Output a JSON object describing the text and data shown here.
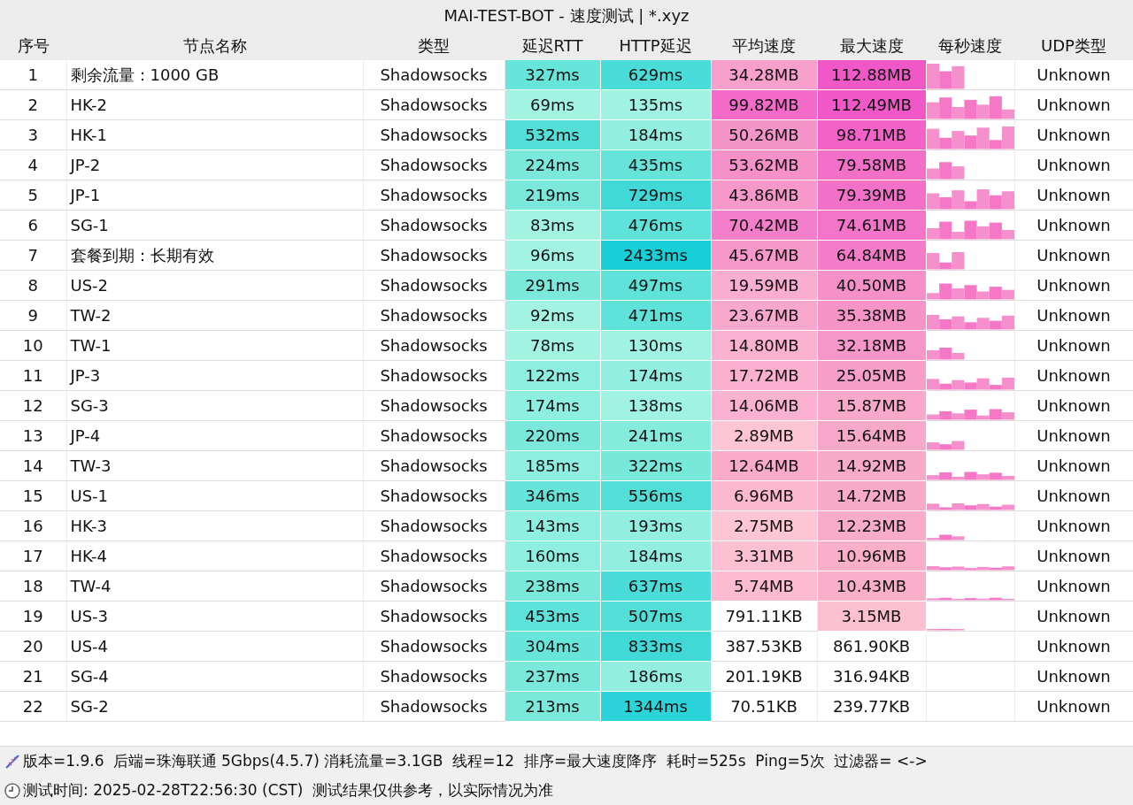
{
  "window": {
    "title": "MAI-TEST-BOT - 速度测试 | *.xyz"
  },
  "table": {
    "columns": [
      "序号",
      "节点名称",
      "类型",
      "延迟RTT",
      "HTTP延迟",
      "平均速度",
      "最大速度",
      "每秒速度",
      "UDP类型"
    ],
    "rows": [
      {
        "index": "1",
        "name": "剩余流量：1000 GB",
        "type": "Shadowsocks",
        "rtt": {
          "text": "327ms",
          "color": "#68e5da"
        },
        "http": {
          "text": "629ms",
          "color": "#4adcd8"
        },
        "avg": {
          "text": "34.28MB",
          "color": "#f7a0cc"
        },
        "max": {
          "text": "112.88MB",
          "color": "#f058c8"
        },
        "udp": "Unknown"
      },
      {
        "index": "2",
        "name": "HK-2",
        "type": "Shadowsocks",
        "rtt": {
          "text": "69ms",
          "color": "#a3f3e3"
        },
        "http": {
          "text": "135ms",
          "color": "#a0f2e2"
        },
        "avg": {
          "text": "99.82MB",
          "color": "#f36ac8"
        },
        "max": {
          "text": "112.49MB",
          "color": "#f058c8"
        },
        "udp": "Unknown"
      },
      {
        "index": "3",
        "name": "HK-1",
        "type": "Shadowsocks",
        "rtt": {
          "text": "532ms",
          "color": "#52dfd8"
        },
        "http": {
          "text": "184ms",
          "color": "#92eedf"
        },
        "avg": {
          "text": "50.26MB",
          "color": "#f594c8"
        },
        "max": {
          "text": "98.71MB",
          "color": "#f262c8"
        },
        "udp": "Unknown"
      },
      {
        "index": "4",
        "name": "JP-2",
        "type": "Shadowsocks",
        "rtt": {
          "text": "224ms",
          "color": "#7ae9dc"
        },
        "http": {
          "text": "435ms",
          "color": "#66e4d9"
        },
        "avg": {
          "text": "53.62MB",
          "color": "#f590c8"
        },
        "max": {
          "text": "79.58MB",
          "color": "#f370c9"
        },
        "udp": "Unknown"
      },
      {
        "index": "5",
        "name": "JP-1",
        "type": "Shadowsocks",
        "rtt": {
          "text": "219ms",
          "color": "#7ae9dc"
        },
        "http": {
          "text": "729ms",
          "color": "#40d9d8"
        },
        "avg": {
          "text": "43.86MB",
          "color": "#f698c9"
        },
        "max": {
          "text": "79.39MB",
          "color": "#f370c9"
        },
        "udp": "Unknown"
      },
      {
        "index": "6",
        "name": "SG-1",
        "type": "Shadowsocks",
        "rtt": {
          "text": "83ms",
          "color": "#a3f3e3"
        },
        "http": {
          "text": "476ms",
          "color": "#5ee2d9"
        },
        "avg": {
          "text": "70.42MB",
          "color": "#f37ec9"
        },
        "max": {
          "text": "74.61MB",
          "color": "#f374c9"
        },
        "udp": "Unknown"
      },
      {
        "index": "7",
        "name": "套餐到期：长期有效",
        "type": "Shadowsocks",
        "rtt": {
          "text": "96ms",
          "color": "#a3f3e3"
        },
        "http": {
          "text": "2433ms",
          "color": "#18cfd8"
        },
        "avg": {
          "text": "45.67MB",
          "color": "#f698c9"
        },
        "max": {
          "text": "64.84MB",
          "color": "#f47cc9"
        },
        "udp": "Unknown"
      },
      {
        "index": "8",
        "name": "US-2",
        "type": "Shadowsocks",
        "rtt": {
          "text": "291ms",
          "color": "#7ae9dc"
        },
        "http": {
          "text": "497ms",
          "color": "#5ee2d9"
        },
        "avg": {
          "text": "19.59MB",
          "color": "#f9aecf"
        },
        "max": {
          "text": "40.50MB",
          "color": "#f690c8"
        },
        "udp": "Unknown"
      },
      {
        "index": "9",
        "name": "TW-2",
        "type": "Shadowsocks",
        "rtt": {
          "text": "92ms",
          "color": "#a3f3e3"
        },
        "http": {
          "text": "471ms",
          "color": "#5ee2d9"
        },
        "avg": {
          "text": "23.67MB",
          "color": "#f8a8cd"
        },
        "max": {
          "text": "35.38MB",
          "color": "#f694c8"
        },
        "udp": "Unknown"
      },
      {
        "index": "10",
        "name": "TW-1",
        "type": "Shadowsocks",
        "rtt": {
          "text": "78ms",
          "color": "#a3f3e3"
        },
        "http": {
          "text": "130ms",
          "color": "#a0f2e2"
        },
        "avg": {
          "text": "14.80MB",
          "color": "#fab2d0"
        },
        "max": {
          "text": "32.18MB",
          "color": "#f796c8"
        },
        "udp": "Unknown"
      },
      {
        "index": "11",
        "name": "JP-3",
        "type": "Shadowsocks",
        "rtt": {
          "text": "122ms",
          "color": "#8eeedf"
        },
        "http": {
          "text": "174ms",
          "color": "#92eedf"
        },
        "avg": {
          "text": "17.72MB",
          "color": "#fbb0d0"
        },
        "max": {
          "text": "25.05MB",
          "color": "#f79ec9"
        },
        "udp": "Unknown"
      },
      {
        "index": "12",
        "name": "SG-3",
        "type": "Shadowsocks",
        "rtt": {
          "text": "174ms",
          "color": "#8eeedf"
        },
        "http": {
          "text": "138ms",
          "color": "#a0f2e2"
        },
        "avg": {
          "text": "14.06MB",
          "color": "#fab2d0"
        },
        "max": {
          "text": "15.87MB",
          "color": "#f8a8c9"
        },
        "udp": "Unknown"
      },
      {
        "index": "13",
        "name": "JP-4",
        "type": "Shadowsocks",
        "rtt": {
          "text": "220ms",
          "color": "#7ae9dc"
        },
        "http": {
          "text": "241ms",
          "color": "#85ebdd"
        },
        "avg": {
          "text": "2.89MB",
          "color": "#fec6d5"
        },
        "max": {
          "text": "15.64MB",
          "color": "#f8a8c9"
        },
        "udp": "Unknown"
      },
      {
        "index": "14",
        "name": "TW-3",
        "type": "Shadowsocks",
        "rtt": {
          "text": "185ms",
          "color": "#8eeedf"
        },
        "http": {
          "text": "322ms",
          "color": "#78e8db"
        },
        "avg": {
          "text": "12.64MB",
          "color": "#f9abc9"
        },
        "max": {
          "text": "14.92MB",
          "color": "#f8aac9"
        },
        "udp": "Unknown"
      },
      {
        "index": "15",
        "name": "US-1",
        "type": "Shadowsocks",
        "rtt": {
          "text": "346ms",
          "color": "#68e5da"
        },
        "http": {
          "text": "556ms",
          "color": "#52dfd8"
        },
        "avg": {
          "text": "6.96MB",
          "color": "#fbb8cf"
        },
        "max": {
          "text": "14.72MB",
          "color": "#f8aac9"
        },
        "udp": "Unknown"
      },
      {
        "index": "16",
        "name": "HK-3",
        "type": "Shadowsocks",
        "rtt": {
          "text": "143ms",
          "color": "#8eeedf"
        },
        "http": {
          "text": "193ms",
          "color": "#92eedf"
        },
        "avg": {
          "text": "2.75MB",
          "color": "#fec6d5"
        },
        "max": {
          "text": "12.23MB",
          "color": "#f9acc9"
        },
        "udp": "Unknown"
      },
      {
        "index": "17",
        "name": "HK-4",
        "type": "Shadowsocks",
        "rtt": {
          "text": "160ms",
          "color": "#8eeedf"
        },
        "http": {
          "text": "184ms",
          "color": "#92eedf"
        },
        "avg": {
          "text": "3.31MB",
          "color": "#fdc0d2"
        },
        "max": {
          "text": "10.96MB",
          "color": "#f9aec9"
        },
        "udp": "Unknown"
      },
      {
        "index": "18",
        "name": "TW-4",
        "type": "Shadowsocks",
        "rtt": {
          "text": "238ms",
          "color": "#7ae9dc"
        },
        "http": {
          "text": "637ms",
          "color": "#4adcd8"
        },
        "avg": {
          "text": "5.74MB",
          "color": "#fcbbd0"
        },
        "max": {
          "text": "10.43MB",
          "color": "#f9aec9"
        },
        "udp": "Unknown"
      },
      {
        "index": "19",
        "name": "US-3",
        "type": "Shadowsocks",
        "rtt": {
          "text": "453ms",
          "color": "#5ee2d9"
        },
        "http": {
          "text": "507ms",
          "color": "#52dfd8"
        },
        "avg": {
          "text": "791.11KB"
        },
        "max": {
          "text": "3.15MB",
          "color": "#fdc0d0"
        },
        "udp": "Unknown"
      },
      {
        "index": "20",
        "name": "US-4",
        "type": "Shadowsocks",
        "rtt": {
          "text": "304ms",
          "color": "#68e5da"
        },
        "http": {
          "text": "833ms",
          "color": "#40d9d8"
        },
        "avg": {
          "text": "387.53KB"
        },
        "max": {
          "text": "861.90KB"
        },
        "udp": "Unknown"
      },
      {
        "index": "21",
        "name": "SG-4",
        "type": "Shadowsocks",
        "rtt": {
          "text": "237ms",
          "color": "#7ae9dc"
        },
        "http": {
          "text": "186ms",
          "color": "#92eedf"
        },
        "avg": {
          "text": "201.19KB"
        },
        "max": {
          "text": "316.94KB"
        },
        "udp": "Unknown"
      },
      {
        "index": "22",
        "name": "SG-2",
        "type": "Shadowsocks",
        "rtt": {
          "text": "213ms",
          "color": "#7ae9dc"
        },
        "http": {
          "text": "1344ms",
          "color": "#2ad4d8"
        },
        "avg": {
          "text": "70.51KB"
        },
        "max": {
          "text": "239.77KB"
        },
        "udp": "Unknown"
      }
    ]
  },
  "status_bar": [
    {
      "kind": "info",
      "text": "版本=1.9.6  后端=珠海联通 5Gbps(4.5.7) 消耗流量=3.1GB  线程=12  排序=最大速度降序  耗时=525s  Ping=5次  过滤器= <->"
    },
    {
      "kind": "time",
      "text": "测试时间: 2025-02-28T22:56:30 (CST)  测试结果仅供参考，以实际情况为准"
    }
  ]
}
